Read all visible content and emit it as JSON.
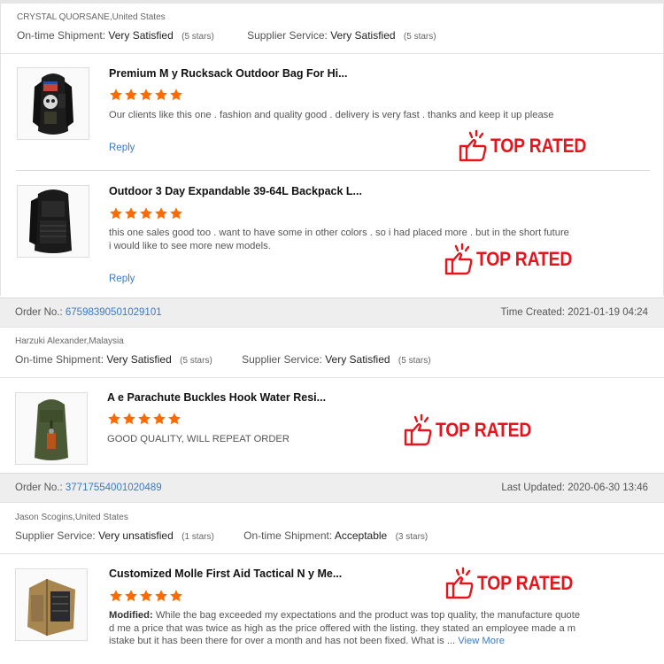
{
  "badge_text": "TOP RATED",
  "colors": {
    "badge_red": "#e8141b",
    "star_orange": "#ff6a00",
    "link_blue": "#3a7ac9"
  },
  "reviews": [
    {
      "buyer": "CRYSTAL QUORSANE,United States",
      "ratings": [
        {
          "label": "On-time Shipment:",
          "value": "Very Satisfied",
          "count": "(5 stars)"
        },
        {
          "label": "Supplier Service:",
          "value": "Very Satisfied",
          "count": "(5 stars)"
        }
      ],
      "items": [
        {
          "title": "Premium M      y Rucksack Outdoor Bag For Hi...",
          "stars": 5,
          "text": "Our clients like this one . fashion and quality good .  delivery is very fast .  thanks and keep it up please",
          "reply": "Reply",
          "image": "black-skull-backpack-image"
        },
        {
          "title": "Outdoor 3 Day Expandable 39-64L Backpack L...",
          "stars": 5,
          "text_line1": "this one sales good too .  want to have some in other colors . so i had placed more .  but in the short future",
          "text_line2": "i would like to see more new models.",
          "reply": "Reply",
          "image": "black-tactical-backpack-image"
        }
      ]
    },
    {
      "order_label": "Order No.:",
      "order_no": "67598390501029101",
      "time_label": "Time Created:",
      "time_value": "2021-01-19 04:24",
      "buyer": "Harzuki Alexander,Malaysia",
      "ratings": [
        {
          "label": "On-time Shipment:",
          "value": "Very Satisfied",
          "count": "(5 stars)"
        },
        {
          "label": "Supplier Service:",
          "value": "Very Satisfied",
          "count": "(5 stars)"
        }
      ],
      "items": [
        {
          "title": "A      e Parachute Buckles Hook Water Resi...",
          "stars": 5,
          "text": "GOOD QUALITY, WILL REPEAT ORDER",
          "image": "green-parachute-bag-image"
        }
      ]
    },
    {
      "order_label": "Order No.:",
      "order_no": "37717554001020489",
      "time_label": "Last Updated:",
      "time_value": "2020-06-30 13:46",
      "buyer": "Jason Scogins,United States",
      "ratings": [
        {
          "label": "Supplier Service:",
          "value": "Very unsatisfied",
          "count": "(1 stars)"
        },
        {
          "label": "On-time Shipment:",
          "value": "Acceptable",
          "count": "(3 stars)"
        }
      ],
      "items": [
        {
          "title": "Customized Molle First Aid Tactical N      y Me...",
          "stars": 5,
          "modified_label": "Modified:",
          "text_line1": "While the bag exceeded my expectations and the product was top quality, the manufacture quote",
          "text_line2": "d me a price that was twice as high as the price offered with the listing.  they stated an employee made a m",
          "text_line3": "istake but it has been there for over a month and has not been fixed.  What is ...",
          "view_more": "View More",
          "image": "tan-medical-backpack-image"
        }
      ]
    }
  ]
}
